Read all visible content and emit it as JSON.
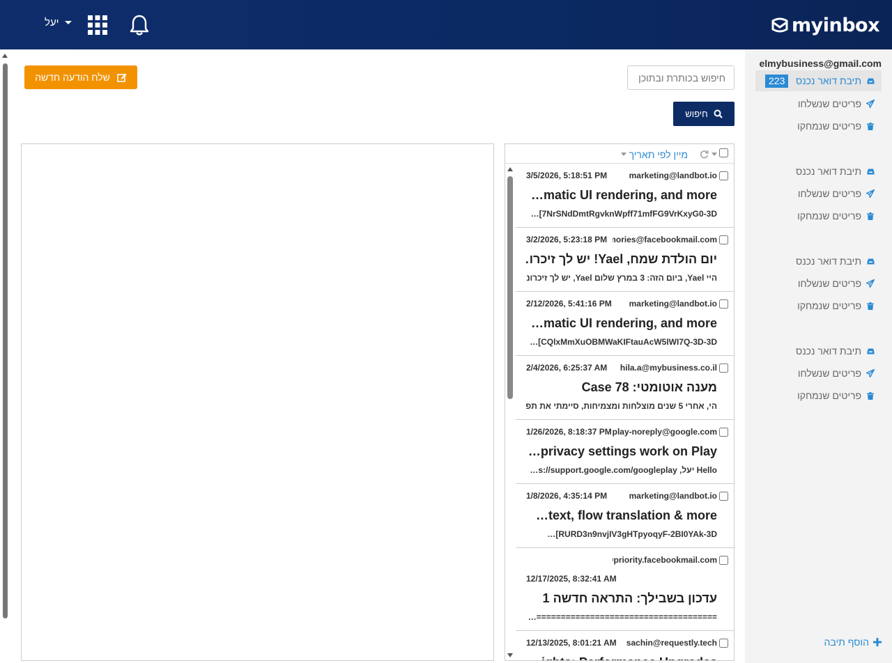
{
  "header": {
    "logo_text": "myinbox",
    "user_name": "יעל",
    "apps_icon": "grid-icon",
    "notifications_icon": "bell-icon"
  },
  "sidebar": {
    "account_email": "elmybusiness@gmail.com",
    "groups": [
      {
        "inbox": "תיבת דואר נכנס",
        "sent": "פריטים שנשלחו",
        "deleted": "פריטים שנמחקו",
        "unread": "223"
      },
      {
        "inbox": "תיבת דואר נכנס",
        "sent": "פריטים שנשלחו",
        "deleted": "פריטים שנמחקו"
      },
      {
        "inbox": "תיבת דואר נכנס",
        "sent": "פריטים שנשלחו",
        "deleted": "פריטים שנמחקו"
      },
      {
        "inbox": "תיבת דואר נכנס",
        "sent": "פריטים שנשלחו",
        "deleted": "פריטים שנמחקו"
      }
    ],
    "add_folder": "הוסף תיבה"
  },
  "toolbar": {
    "compose_label": "שלח הודעה חדשה",
    "search_placeholder": "חיפוש בכותרת ובתוכן",
    "search_button": "חיפוש"
  },
  "list": {
    "sort_label": "מיין לפי תאריך",
    "messages": [
      {
        "from": "marketing@landbot.io",
        "date": "3/5/2026, 5:18:51 PM",
        "subject": "matic UI rendering, and more…",
        "snippet": "7NrSNdDmtRgvknWpff71mfFG9VrKxyG0-3D]…"
      },
      {
        "from": "memories@facebookmail.com",
        "date": "3/2/2026, 5:23:18 PM",
        "subject": "יום הולדת שמח, Yael! יש לך זיכרו…",
        "snippet": "היי Yael, ביום הזה: 3 במרץ שלום Yael, יש לך זיכרונ…"
      },
      {
        "from": "marketing@landbot.io",
        "date": "2/12/2026, 5:41:16 PM",
        "subject": "matic UI rendering, and more…",
        "snippet": "CQlxMmXuOBMWaKIFtauAcW5IWI7Q-3D-3D]…"
      },
      {
        "from": "hila.a@mybusiness.co.il",
        "date": "2/4/2026, 6:25:37 AM",
        "subject": "מענה אוטומטי: Case 78",
        "snippet": "הי, אחרי 5 שנים מוצלחות ומצמיחות, סיימתי את תפ…"
      },
      {
        "from": "googleplay-noreply@google.com",
        "date": "1/26/2026, 8:18:37 PM",
        "subject": "privacy settings work on Play…",
        "snippet": "Hello יעל, s://support.google.com/googleplay…"
      },
      {
        "from": "marketing@landbot.io",
        "date": "1/8/2026, 4:35:14 PM",
        "subject": "text, flow translation & more…",
        "snippet": "RURD3n9nvjIV3gHTpyoqyF-2BI0YAk-3D]…"
      },
      {
        "from": "notification@priority.facebookmail.com",
        "date": "12/17/2025, 8:32:41 AM",
        "subject": "עדכון בשבילך: התראה חדשה 1",
        "snippet": "=====================================…"
      },
      {
        "from": "sachin@requestly.tech",
        "date": "12/13/2025, 8:01:21 AM",
        "subject": "ights: Performance Upgrades",
        "snippet": ""
      }
    ]
  }
}
